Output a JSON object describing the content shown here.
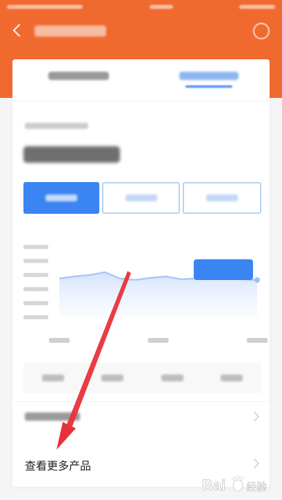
{
  "header": {
    "background_color": "#f06a2f",
    "back_icon": "chevron-left-icon",
    "info_icon": "info-circle-icon"
  },
  "card": {
    "tabs": [
      {
        "state": "inactive"
      },
      {
        "state": "active",
        "accent_color": "#3a7ff0"
      }
    ],
    "period_tabs": [
      {
        "state": "selected"
      },
      {
        "state": "unselected"
      },
      {
        "state": "unselected"
      }
    ],
    "accent_color": "#3a85f2"
  },
  "chart_data": {
    "type": "line",
    "y_ticks": 6,
    "x_ticks": 3,
    "series": [
      {
        "values": [
          0.55,
          0.58,
          0.6,
          0.64,
          0.55,
          0.53,
          0.56,
          0.58,
          0.54,
          0.55,
          0.54,
          0.55,
          0.54,
          0.53
        ]
      }
    ],
    "grid": false,
    "line_color": "#a9c8f5"
  },
  "list": {
    "more_products_label": "查看更多产品"
  },
  "watermark": {
    "logo": "baidu-jingyan-logo",
    "text": "Bai",
    "sub_text": "经验"
  }
}
